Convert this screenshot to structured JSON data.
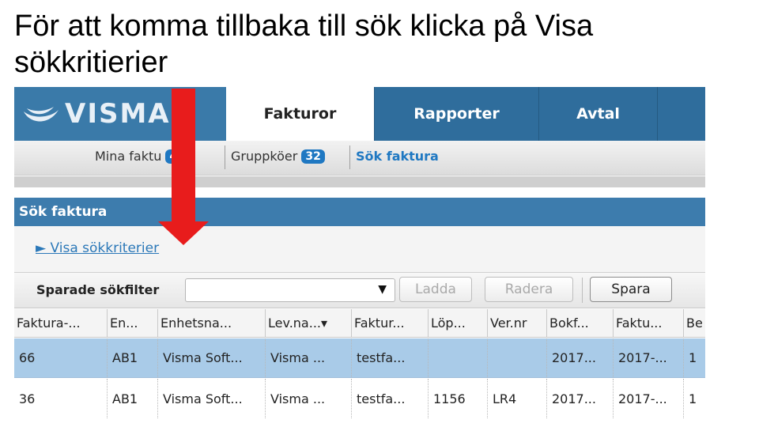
{
  "slide_title": "För att komma tillbaka till sök klicka på Visa sökkritierier",
  "app": {
    "logo_text": "VISMA",
    "tabs": [
      {
        "label": "Fakturor",
        "active": true
      },
      {
        "label": "Rapporter",
        "active": false
      },
      {
        "label": "Avtal",
        "active": false
      }
    ],
    "subnav": {
      "items": [
        {
          "label": "Mina faktu",
          "count": "4"
        },
        {
          "label": "Gruppköer",
          "count": "32"
        },
        {
          "label": "Sök faktura"
        }
      ]
    },
    "section_title": "Sök faktura",
    "criteria_toggle": "► Visa sökkriterier",
    "toolbar": {
      "saved_filters_label": "Sparade sökfilter",
      "select_value": "",
      "select_arrow": "▼",
      "load_label": "Ladda",
      "delete_label": "Radera",
      "save_label": "Spara"
    },
    "table": {
      "headers": [
        "Faktura-...",
        "En...",
        "Enhetsna...",
        "Lev.na...▾",
        "Faktur...",
        "Löp...",
        "Ver.nr",
        "Bokf...",
        "Faktu...",
        "Be"
      ],
      "rows": [
        [
          "66",
          "AB1",
          "Visma Soft...",
          "Visma ...",
          "testfa...",
          "",
          "",
          "2017...",
          "2017-...",
          "1"
        ],
        [
          "36",
          "AB1",
          "Visma Soft...",
          "Visma ...",
          "testfa...",
          "1156",
          "LR4",
          "2017...",
          "2017-...",
          "1"
        ]
      ],
      "selected_row_color": "#a9cbe8"
    }
  },
  "annotation": {
    "type": "arrow-down",
    "color": "#e81c1c"
  }
}
